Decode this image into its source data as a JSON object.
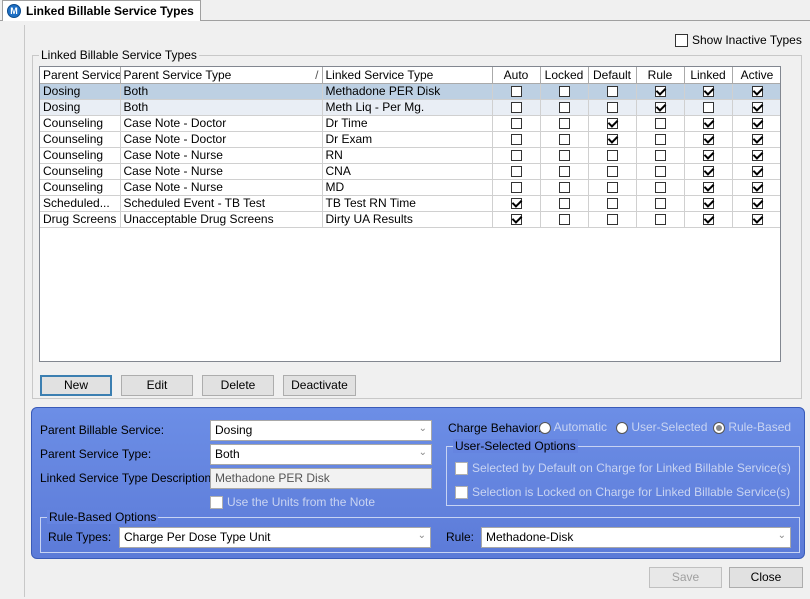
{
  "tab": {
    "title": "Linked Billable Service Types",
    "icon": "app-logo-icon"
  },
  "show_inactive": {
    "label": "Show Inactive Types",
    "checked": false
  },
  "grid": {
    "group_title": "Linked Billable Service Types",
    "columns": [
      "Parent Service",
      "Parent Service Type",
      "Linked Service Type",
      "Auto",
      "Locked",
      "Default",
      "Rule",
      "Linked",
      "Active"
    ],
    "sort_indicator": "/",
    "rows": [
      {
        "parent": "Dosing",
        "ptype": "Both",
        "linked": "Methadone PER Disk",
        "flags": [
          false,
          false,
          false,
          true,
          true,
          true
        ]
      },
      {
        "parent": "Dosing",
        "ptype": "Both",
        "linked": "Meth Liq - Per Mg.",
        "flags": [
          false,
          false,
          false,
          true,
          false,
          true
        ]
      },
      {
        "parent": "Counseling",
        "ptype": "Case Note - Doctor",
        "linked": "Dr Time",
        "flags": [
          false,
          false,
          true,
          false,
          true,
          true
        ]
      },
      {
        "parent": "Counseling",
        "ptype": "Case Note - Doctor",
        "linked": "Dr Exam",
        "flags": [
          false,
          false,
          true,
          false,
          true,
          true
        ]
      },
      {
        "parent": "Counseling",
        "ptype": "Case Note - Nurse",
        "linked": "RN",
        "flags": [
          false,
          false,
          false,
          false,
          true,
          true
        ]
      },
      {
        "parent": "Counseling",
        "ptype": "Case Note - Nurse",
        "linked": "CNA",
        "flags": [
          false,
          false,
          false,
          false,
          true,
          true
        ]
      },
      {
        "parent": "Counseling",
        "ptype": "Case Note - Nurse",
        "linked": "MD",
        "flags": [
          false,
          false,
          false,
          false,
          true,
          true
        ]
      },
      {
        "parent": "Scheduled...",
        "ptype": "Scheduled Event - TB Test",
        "linked": "TB Test RN Time",
        "flags": [
          true,
          false,
          false,
          false,
          true,
          true
        ]
      },
      {
        "parent": "Drug Screens",
        "ptype": "Unacceptable Drug Screens",
        "linked": "Dirty UA Results",
        "flags": [
          true,
          false,
          false,
          false,
          true,
          true
        ]
      }
    ]
  },
  "buttons": {
    "new": "New",
    "edit": "Edit",
    "delete": "Delete",
    "deactivate": "Deactivate",
    "save": "Save",
    "close": "Close"
  },
  "detail": {
    "parent_billable_label": "Parent Billable Service:",
    "parent_billable_value": "Dosing",
    "parent_type_label": "Parent Service Type:",
    "parent_type_value": "Both",
    "linked_desc_label": "Linked Service Type Description:",
    "linked_desc_value": "Methadone PER Disk",
    "use_units_label": "Use the Units from the Note",
    "charge_behavior_label": "Charge Behavior:",
    "charge_options": [
      "Automatic",
      "User-Selected",
      "Rule-Based"
    ],
    "charge_selected": "Rule-Based",
    "user_selected_group": "User-Selected Options",
    "user_opt1": "Selected by Default on Charge for Linked Billable Service(s)",
    "user_opt2": "Selection is Locked on Charge for Linked Billable Service(s)",
    "rule_group": "Rule-Based Options",
    "rule_types_label": "Rule Types:",
    "rule_types_value": "Charge Per Dose Type Unit",
    "rule_label": "Rule:",
    "rule_value": "Methadone-Disk"
  },
  "colors": {
    "panel": "#6584e0",
    "selected_row": "#bdd0e3",
    "accent_border": "#3c7fb1"
  }
}
